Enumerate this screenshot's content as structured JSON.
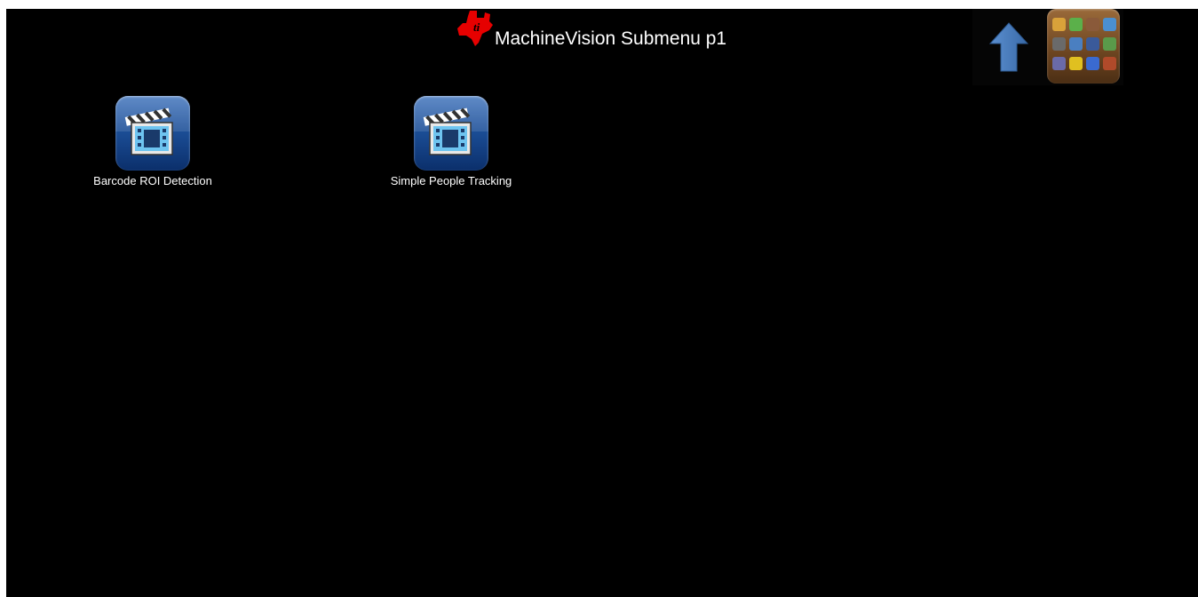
{
  "header": {
    "title": "MachineVision Submenu p1",
    "logo": "ti-logo-icon"
  },
  "controls": {
    "up_icon": "up-arrow-icon",
    "home_icon": "home-grid-icon"
  },
  "apps": [
    {
      "label": "Barcode ROI Detection",
      "icon": "video-clapper-icon"
    },
    {
      "label": "Simple People Tracking",
      "icon": "video-clapper-icon"
    }
  ],
  "colors": {
    "background": "#000000",
    "text": "#ffffff",
    "ti_red": "#e60000",
    "arrow_blue": "#4a7fc1",
    "app_icon_blue": "#1c4f98"
  }
}
